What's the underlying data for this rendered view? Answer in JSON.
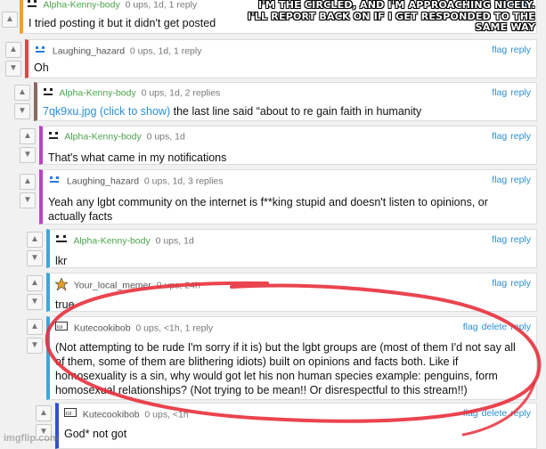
{
  "caption": "I'M THE CIRCLED, AND I'M APPROACHING NICELY. I'LL REPORT BACK ON IF I GET RESPONDED TO THE SAME WAY",
  "watermark": "imgflip.com",
  "vote_up_icon": "arrow-up-icon",
  "vote_down_icon": "arrow-down-icon",
  "colors": {
    "accent_link": "#2a8fd6",
    "username_green": "#4aa34a",
    "circle_red": "#e8303c"
  },
  "comments": [
    {
      "user": "Alpha-Kenny-body",
      "meta": "0 ups, 1d, 1 reply",
      "actions": [
        "reply"
      ],
      "text": "I tried posting it but it didn't get posted",
      "border": "#f0a030"
    },
    {
      "user": "Laughing_hazard",
      "meta": "0 ups, 1d, 1 reply",
      "actions": [
        "flag",
        "reply"
      ],
      "text": "Oh",
      "border": "#e04545"
    },
    {
      "user": "Alpha-Kenny-body",
      "meta": "0 ups, 1d, 2 replies",
      "actions": [
        "flag",
        "reply"
      ],
      "link": "7qk9xu.jpg (click to show)",
      "text": " the last line said “about to re gain faith in humanity",
      "border": "#8a6a60"
    },
    {
      "user": "Alpha-Kenny-body",
      "meta": "0 ups, 1d",
      "actions": [
        "flag",
        "reply"
      ],
      "text": "That's what came in my notifications",
      "border": "#c040c8"
    },
    {
      "user": "Laughing_hazard",
      "meta": "0 ups, 1d, 3 replies",
      "actions": [
        "flag",
        "reply"
      ],
      "text": "Yeah any lgbt community on the internet is f**king stupid and doesn't listen to opinions, or actually facts",
      "border": "#c040c8"
    },
    {
      "user": "Alpha-Kenny-body",
      "meta": "0 ups, 1d",
      "actions": [
        "flag",
        "reply"
      ],
      "text": "lkr",
      "border": "#3aa8e0"
    },
    {
      "user": "Your_local_memer",
      "meta": "0 ups, 24h",
      "actions": [
        "flag",
        "reply"
      ],
      "text": "true",
      "border": "#3aa8e0"
    },
    {
      "user": "Kutecookibob",
      "meta": "0 ups, <1h, 1 reply",
      "actions": [
        "flag",
        "delete",
        "reply"
      ],
      "text": "(Not attempting to be rude I'm sorry if it is) but the lgbt groups are (most of them I'd not say all of them, some of them are blithering idiots) built on opinions and facts both. Like if homosexuality is a sin, why would got let his non human species example: penguins, form homosexual relationships? (Not trying to be mean!! Or disrespectful to this stream!!)",
      "border": "#3aa8e0"
    },
    {
      "user": "Kutecookibob",
      "meta": "0 ups, <1h",
      "actions": [
        "flag",
        "delete",
        "reply"
      ],
      "text": "God* not got",
      "border": "#3050d0"
    }
  ]
}
